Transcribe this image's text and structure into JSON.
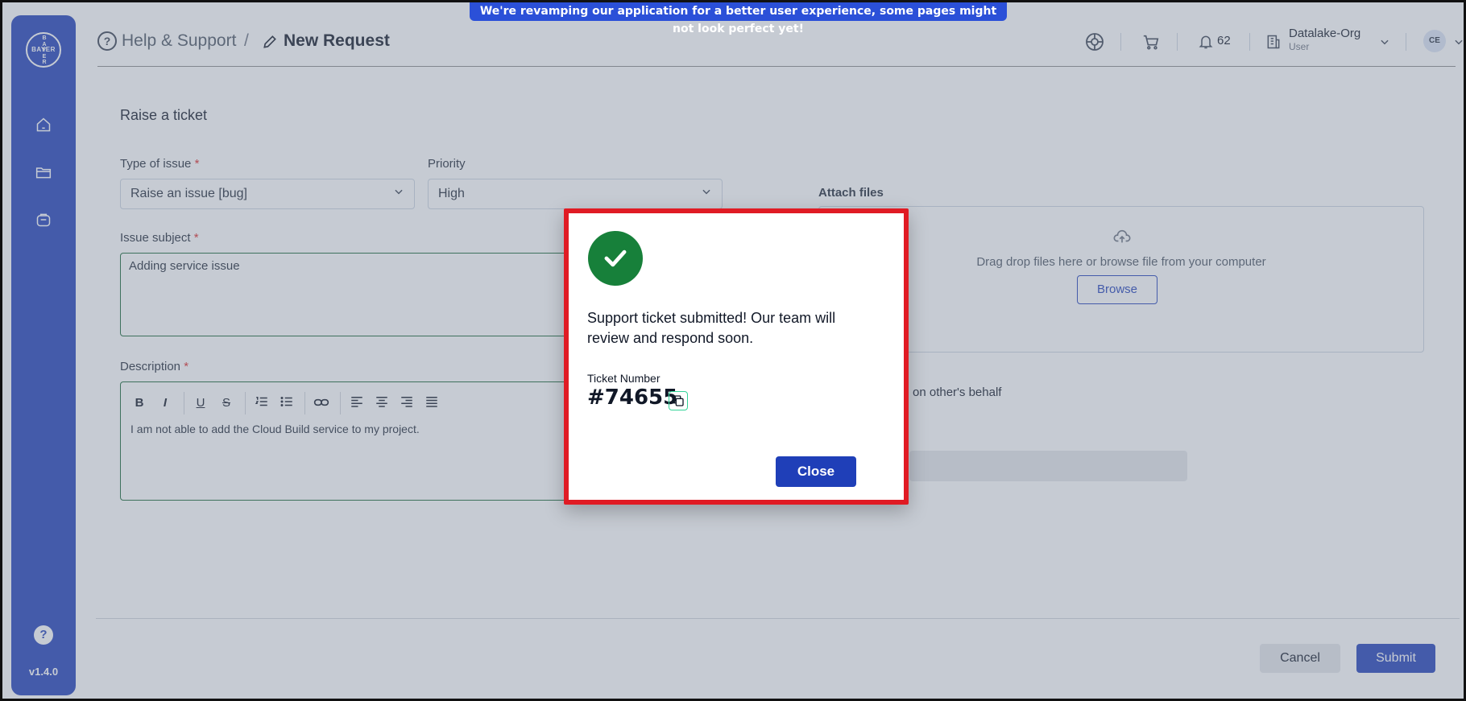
{
  "banner": {
    "text": "We're revamping our application for a better user experience, some pages might not look perfect yet!"
  },
  "sidebar": {
    "logo": {
      "h_text": "BAYER",
      "v_text": "B A Y E R"
    },
    "version": "v1.4.0",
    "help_label": "?"
  },
  "header": {
    "help_icon_label": "?",
    "breadcrumb_parent": "Help & Support",
    "breadcrumb_sep": "/",
    "breadcrumb_current": "New Request",
    "notification_count": "62",
    "org_name": "Datalake-Org",
    "org_role": "User",
    "avatar_initials": "CE"
  },
  "form": {
    "title": "Raise a ticket",
    "type_label": "Type of issue",
    "type_value": "Raise an issue [bug]",
    "priority_label": "Priority",
    "priority_value": "High",
    "subject_label": "Issue subject",
    "subject_value": "Adding service issue",
    "description_label": "Description",
    "description_value": "I am not able to add the Cloud Build service to my project.",
    "required_mark": "*",
    "toolbar": {
      "bold": "B",
      "italic": "I",
      "underline": "U",
      "strike": "S"
    },
    "attach_label": "Attach files",
    "drop_text": "Drag drop files here or browse file from your computer",
    "browse_label": "Browse",
    "behalf_text": "on other's behalf",
    "cancel_label": "Cancel",
    "submit_label": "Submit"
  },
  "modal": {
    "message": "Support ticket submitted! Our team will review and respond soon.",
    "ticket_label": "Ticket Number",
    "ticket_number": "#74655",
    "close_label": "Close"
  },
  "colors": {
    "primary": "#1f3fb8",
    "success": "#17803a",
    "highlight": "#e01b24"
  }
}
